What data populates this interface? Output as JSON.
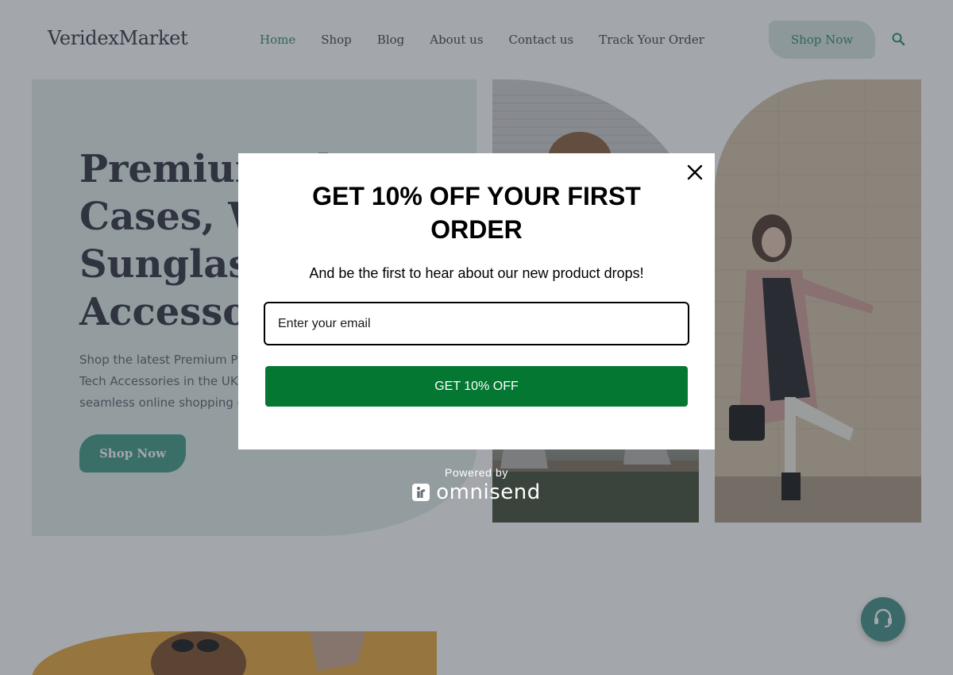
{
  "header": {
    "logo": "VeridexMarket",
    "nav": [
      {
        "label": "Home",
        "active": true
      },
      {
        "label": "Shop",
        "active": false
      },
      {
        "label": "Blog",
        "active": false
      },
      {
        "label": "About us",
        "active": false
      },
      {
        "label": "Contact us",
        "active": false
      },
      {
        "label": "Track Your Order",
        "active": false
      }
    ],
    "cta_label": "Shop Now",
    "search_icon": "search-icon"
  },
  "hero": {
    "title": "Premium Phone Cases, Watches, Sunglasses & Accessories",
    "subtitle": "Shop the latest Premium Phone Cases, Watches, Sunglasses & Tech Accessories in the UK delivered to your door with a seamless online shopping experience.",
    "cta_label": "Shop Now"
  },
  "support_icon": "headset-icon",
  "popup": {
    "title": "GET 10% OFF YOUR FIRST ORDER",
    "subtitle": "And be the first to hear about our new product drops!",
    "email_placeholder": "Enter your email",
    "submit_label": "GET 10% OFF",
    "close_icon": "close-icon"
  },
  "powered_by": {
    "label": "Powered by",
    "brand": "omnisend"
  },
  "colors": {
    "accent": "#2a8a74",
    "hero_bg": "#e2efec",
    "submit_bg": "#047732",
    "overlay": "rgba(55,60,70,0.46)"
  }
}
